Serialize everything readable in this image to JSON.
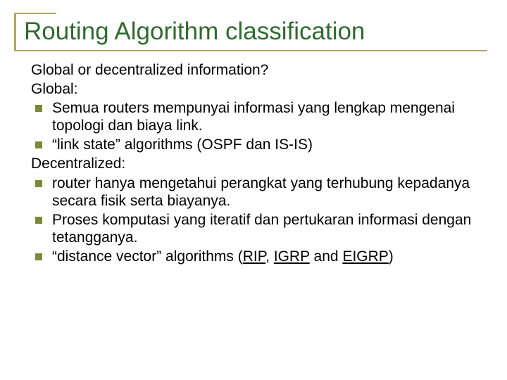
{
  "title": "Routing Algorithm classification",
  "q1": "Global or decentralized information?",
  "global_label": "Global:",
  "global_b1": "Semua routers mempunyai informasi yang lengkap mengenai topologi dan biaya link.",
  "global_b2": "“link state” algorithms (OSPF dan IS-IS)",
  "decentral_label": "Decentralized:",
  "decentral_b1": "router hanya mengetahui perangkat yang terhubung kepadanya secara fisik serta biayanya.",
  "decentral_b2": "Proses komputasi yang iteratif dan pertukaran informasi dengan tetangganya.",
  "dv_prefix": "“distance vector” algorithms (",
  "dv_link1": "RIP",
  "dv_sep1": ", ",
  "dv_link2": "IGRP",
  "dv_sep2": " and ",
  "dv_link3": "EIGRP",
  "dv_suffix": ")"
}
